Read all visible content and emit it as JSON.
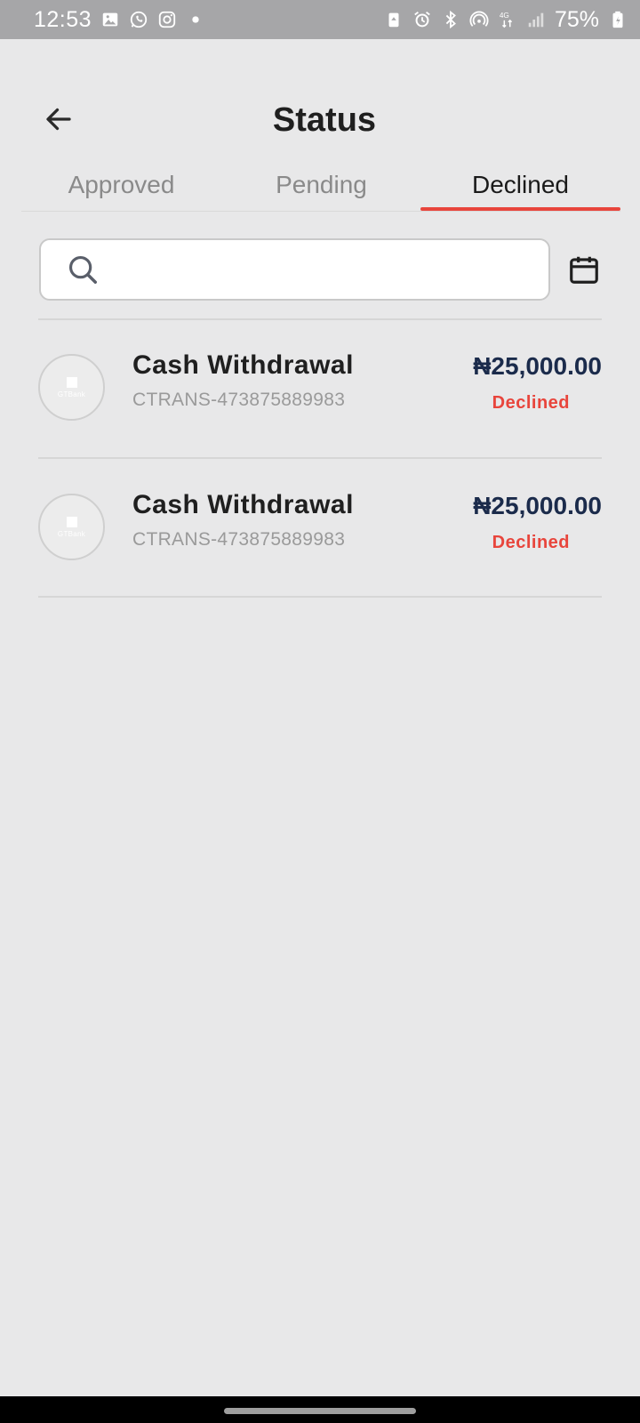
{
  "status_bar": {
    "time": "12:53",
    "battery": "75%",
    "left_icons": [
      "gallery-icon",
      "whatsapp-icon",
      "instagram-icon",
      "dot-icon"
    ],
    "right_icons": [
      "lock-icon",
      "alarm-icon",
      "bluetooth-icon",
      "hotspot-icon",
      "4g-icon",
      "signal-icon",
      "battery-icon"
    ]
  },
  "header": {
    "title": "Status",
    "back_icon": "arrow-left-icon"
  },
  "tabs": [
    {
      "label": "Approved",
      "active": false
    },
    {
      "label": "Pending",
      "active": false
    },
    {
      "label": "Declined",
      "active": true
    }
  ],
  "search": {
    "placeholder": "",
    "value": "",
    "icon": "search-icon",
    "calendar_icon": "calendar-icon"
  },
  "transactions": [
    {
      "title": "Cash Withdrawal",
      "reference": "CTRANS-473875889983",
      "amount": "₦25,000.00",
      "status": "Declined",
      "avatar_text": "GTBank"
    },
    {
      "title": "Cash Withdrawal",
      "reference": "CTRANS-473875889983",
      "amount": "₦25,000.00",
      "status": "Declined",
      "avatar_text": "GTBank"
    }
  ],
  "colors": {
    "accent": "#e8453c",
    "amount": "#1b2b4b",
    "background": "#e8e8e9"
  }
}
